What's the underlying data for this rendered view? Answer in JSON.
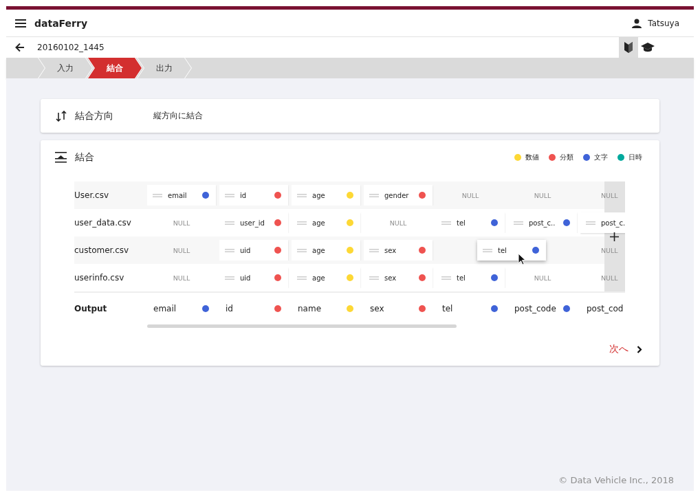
{
  "app": {
    "name": "dataFerry",
    "user": "Tatsuya"
  },
  "project": {
    "title": "20160102_1445"
  },
  "guide_tabs": [
    {
      "kind": "beginner",
      "selected": true
    },
    {
      "kind": "learn",
      "selected": false
    }
  ],
  "steps": [
    {
      "label": "入力",
      "selected": false
    },
    {
      "label": "結合",
      "selected": true
    },
    {
      "label": "出力",
      "selected": false
    }
  ],
  "direction": {
    "title": "結合方向",
    "value": "縦方向に結合"
  },
  "join": {
    "title": "結合",
    "legend": [
      {
        "label": "数値",
        "color": "#fdd835"
      },
      {
        "label": "分類",
        "color": "#ef5350"
      },
      {
        "label": "文字",
        "color": "#3f63d8"
      },
      {
        "label": "日時",
        "color": "#00a99d"
      }
    ],
    "rows": [
      {
        "file": "User.csv",
        "cells": [
          {
            "kind": "field",
            "name": "email",
            "color": "#3f63d8"
          },
          {
            "kind": "field",
            "name": "id",
            "color": "#ef5350"
          },
          {
            "kind": "field",
            "name": "age",
            "color": "#fdd835"
          },
          {
            "kind": "field",
            "name": "gender",
            "color": "#ef5350"
          },
          {
            "kind": "null",
            "name": "NULL"
          },
          {
            "kind": "null",
            "name": "NULL"
          },
          {
            "kind": "null",
            "name": "NULL"
          }
        ]
      },
      {
        "file": "user_data.csv",
        "cells": [
          {
            "kind": "null",
            "name": "NULL"
          },
          {
            "kind": "field",
            "name": "user_id",
            "color": "#ef5350"
          },
          {
            "kind": "field",
            "name": "age",
            "color": "#fdd835"
          },
          {
            "kind": "null",
            "name": "NULL"
          },
          {
            "kind": "field",
            "name": "tel",
            "color": "#3f63d8"
          },
          {
            "kind": "field",
            "name": "post_c..",
            "color": "#3f63d8"
          },
          {
            "kind": "field",
            "name": "post_c."
          }
        ]
      },
      {
        "file": "customer.csv",
        "cells": [
          {
            "kind": "null",
            "name": "NULL"
          },
          {
            "kind": "field",
            "name": "uid",
            "color": "#ef5350"
          },
          {
            "kind": "field",
            "name": "age",
            "color": "#fdd835"
          },
          {
            "kind": "field",
            "name": "sex",
            "color": "#ef5350"
          },
          {
            "kind": "empty"
          },
          {
            "kind": "empty"
          },
          {
            "kind": "null",
            "name": "NULL"
          }
        ]
      },
      {
        "file": "userinfo.csv",
        "cells": [
          {
            "kind": "null",
            "name": "NULL"
          },
          {
            "kind": "field",
            "name": "uid",
            "color": "#ef5350"
          },
          {
            "kind": "field",
            "name": "age",
            "color": "#fdd835"
          },
          {
            "kind": "field",
            "name": "sex",
            "color": "#ef5350"
          },
          {
            "kind": "field",
            "name": "tel",
            "color": "#3f63d8"
          },
          {
            "kind": "null",
            "name": "NULL"
          },
          {
            "kind": "null",
            "name": "NULL"
          }
        ]
      }
    ],
    "dragging": {
      "name": "tel",
      "color": "#3f63d8"
    },
    "output": {
      "label": "Output",
      "cells": [
        {
          "name": "email",
          "color": "#3f63d8"
        },
        {
          "name": "id",
          "color": "#ef5350"
        },
        {
          "name": "name",
          "color": "#fdd835"
        },
        {
          "name": "sex",
          "color": "#ef5350"
        },
        {
          "name": "tel",
          "color": "#3f63d8"
        },
        {
          "name": "post_code",
          "color": "#3f63d8"
        },
        {
          "name": "post_cod"
        }
      ]
    },
    "next": "次へ"
  },
  "footer": "© Data Vehicle Inc., 2018"
}
